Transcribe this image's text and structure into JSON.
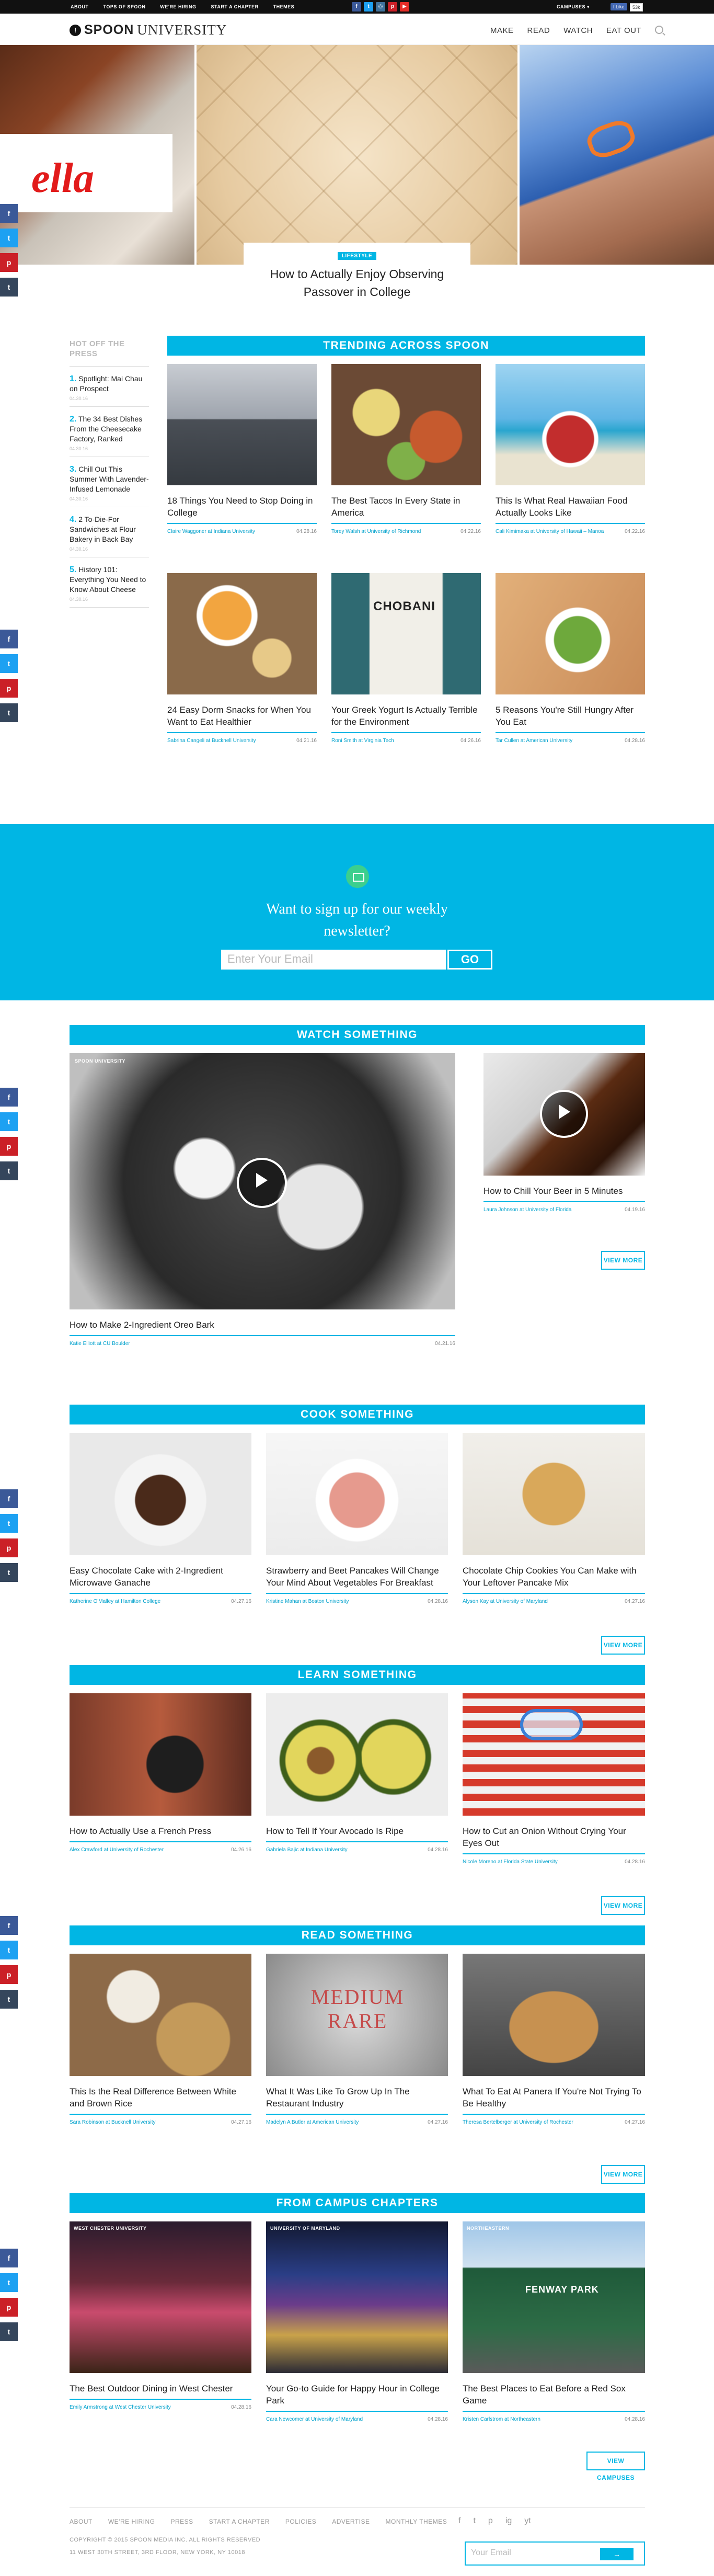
{
  "topbar": {
    "links": [
      "ABOUT",
      "TOPS OF SPOON",
      "WE'RE HIRING",
      "START A CHAPTER",
      "THEMES"
    ],
    "social_icons": [
      "facebook-icon",
      "twitter-icon",
      "instagram-icon",
      "pinterest-icon",
      "youtube-icon"
    ],
    "campuses": "CAMPUSES ▾",
    "like": "f Like",
    "like_count": "53k"
  },
  "header": {
    "logo_spoon": "SPOON",
    "logo_university": "UNIVERSITY",
    "nav": [
      "MAKE",
      "READ",
      "WATCH",
      "EAT OUT"
    ]
  },
  "hero": {
    "tag": "LIFESTYLE",
    "title": "How to Actually Enjoy Observing Passover in College",
    "nutella_text": "ella"
  },
  "hot_off": {
    "heading": "HOT OFF THE PRESS",
    "items": [
      {
        "num": "1.",
        "title": "Spotlight: Mai Chau on Prospect",
        "date": "04.30.16"
      },
      {
        "num": "2.",
        "title": "The 34 Best Dishes From the Cheesecake Factory, Ranked",
        "date": "04.30.16"
      },
      {
        "num": "3.",
        "title": "Chill Out This Summer With Lavender-Infused Lemonade",
        "date": "04.30.16"
      },
      {
        "num": "4.",
        "title": "2 To-Die-For Sandwiches at Flour Bakery in Back Bay",
        "date": "04.30.16"
      },
      {
        "num": "5.",
        "title": "History 101: Everything You Need to Know About Cheese",
        "date": "04.30.16"
      }
    ]
  },
  "trending": {
    "heading": "TRENDING ACROSS SPOON",
    "cards": [
      {
        "title": "18 Things You Need to Stop Doing in College",
        "author": "Claire Waggoner at Indiana University",
        "date": "04.28.16"
      },
      {
        "title": "The Best Tacos In Every State in America",
        "author": "Torey Walsh at University of Richmond",
        "date": "04.22.16"
      },
      {
        "title": "This Is What Real Hawaiian Food Actually Looks Like",
        "author": "Cali Kimimaka at University of Hawaii – Manoa",
        "date": "04.22.16"
      },
      {
        "title": "24 Easy Dorm Snacks for When You Want to Eat Healthier",
        "author": "Sabrina Cangeli at Bucknell University",
        "date": "04.21.16"
      },
      {
        "title": "Your Greek Yogurt Is Actually Terrible for the Environment",
        "author": "Roni Smith at Virginia Tech",
        "date": "04.26.16"
      },
      {
        "title": "5 Reasons You're Still Hungry After You Eat",
        "author": "Tar Cullen at American University",
        "date": "04.28.16"
      }
    ],
    "yogurt_brand": "CHOBANI"
  },
  "newsletter": {
    "question": "Want to sign up for our weekly newsletter?",
    "placeholder": "Enter Your Email",
    "button": "GO"
  },
  "watch": {
    "heading": "WATCH SOMETHING",
    "main": {
      "badge": "SPOON UNIVERSITY",
      "title": "How to Make 2-Ingredient Oreo Bark",
      "author": "Katie Elliott at CU Boulder",
      "date": "04.21.16"
    },
    "side": {
      "title": "How to Chill Your Beer in 5 Minutes",
      "author": "Laura Johnson at University of Florida",
      "date": "04.19.16"
    },
    "view_more": "VIEW MORE"
  },
  "cook": {
    "heading": "COOK SOMETHING",
    "cards": [
      {
        "title": "Easy Chocolate Cake with 2-Ingredient Microwave Ganache",
        "author": "Katherine O'Malley at Hamilton College",
        "date": "04.27.16"
      },
      {
        "title": "Strawberry and Beet Pancakes Will Change Your Mind About Vegetables For Breakfast",
        "author": "Kristine Mahan at Boston University",
        "date": "04.28.16"
      },
      {
        "title": "Chocolate Chip Cookies You Can Make with Your Leftover Pancake Mix",
        "author": "Alyson Kay at University of Maryland",
        "date": "04.27.16"
      }
    ],
    "view_more": "VIEW MORE"
  },
  "learn": {
    "heading": "LEARN SOMETHING",
    "cards": [
      {
        "title": "How to Actually Use a French Press",
        "author": "Alex Crawford at University of Rochester",
        "date": "04.26.16"
      },
      {
        "title": "How to Tell If Your Avocado Is Ripe",
        "author": "Gabriela Bajic at Indiana University",
        "date": "04.28.16"
      },
      {
        "title": "How to Cut an Onion Without Crying Your Eyes Out",
        "author": "Nicole Moreno at Florida State University",
        "date": "04.28.16"
      }
    ],
    "view_more": "VIEW MORE"
  },
  "read": {
    "heading": "READ SOMETHING",
    "cards": [
      {
        "title": "This Is the Real Difference Between White and Brown Rice",
        "author": "Sara Robinson at Bucknell University",
        "date": "04.27.16"
      },
      {
        "title": "What It Was Like To Grow Up In The Restaurant Industry",
        "author": "Madelyn A Butler at American University",
        "date": "04.27.16"
      },
      {
        "title": "What To Eat At Panera If You're Not Trying To Be Healthy",
        "author": "Theresa Bertelberger at University of Rochester",
        "date": "04.27.16"
      }
    ],
    "rare_text": "MEDIUM RARE",
    "view_more": "VIEW MORE"
  },
  "campus": {
    "heading": "FROM CAMPUS CHAPTERS",
    "cards": [
      {
        "badge": "WEST CHESTER UNIVERSITY",
        "title": "The Best Outdoor Dining in West Chester",
        "author": "Emily Armstrong at West Chester University",
        "date": "04.28.16"
      },
      {
        "badge": "UNIVERSITY OF MARYLAND",
        "title": "Your Go-to Guide for Happy Hour in College Park",
        "author": "Cara Newcomer at University of Maryland",
        "date": "04.28.16"
      },
      {
        "badge": "NORTHEASTERN",
        "title": "The Best Places to Eat Before a Red Sox Game",
        "author": "Kristen Carlstrom at Northeastern",
        "date": "04.28.16"
      }
    ],
    "fenway": "FENWAY PARK",
    "view_more": "VIEW CAMPUSES"
  },
  "footer": {
    "links": [
      "ABOUT",
      "WE'RE HIRING",
      "PRESS",
      "START A CHAPTER",
      "POLICIES",
      "ADVERTISE",
      "MONTHLY THEMES"
    ],
    "copyright": "COPYRIGHT © 2015 SPOON MEDIA INC. ALL RIGHTS RESERVED",
    "address": "11 WEST 30TH STREET, 3RD FLOOR, NEW YORK, NY 10018",
    "social": [
      "f",
      "t",
      "p",
      "ig",
      "yt"
    ],
    "email_placeholder": "Your Email",
    "email_button": "→"
  },
  "colors": {
    "accent": "#00b6e4",
    "facebook": "#3b5998",
    "twitter": "#1da1f2",
    "pinterest": "#cb2027",
    "tumblr": "#35465c",
    "newsletter_icon": "#3ccf8e"
  },
  "share_buttons": [
    "f",
    "t",
    "p",
    "t"
  ]
}
